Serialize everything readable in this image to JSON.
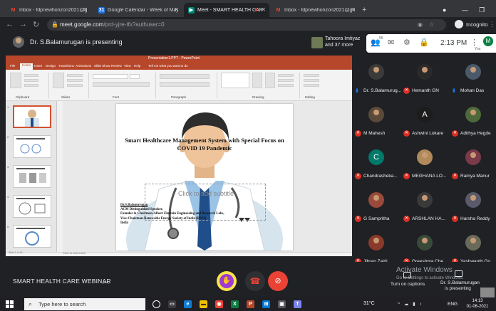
{
  "browser": {
    "tabs": [
      {
        "label": "Inbox - fdpnewhorizon2021@gm",
        "icon": "gmail-icon",
        "active": false
      },
      {
        "label": "Google Calendar - Week of May",
        "icon": "calendar-icon",
        "active": false
      },
      {
        "label": "Meet - SMART HEALTH CAR",
        "icon": "meet-icon",
        "active": true
      },
      {
        "label": "Inbox - fdpnewhorizon2021@gm",
        "icon": "gmail-icon",
        "active": false
      }
    ],
    "url_host": "meet.google.com",
    "url_path": "/prd-yjre-tfx?authuser=0",
    "incognito_label": "Incognito"
  },
  "meet_header": {
    "presenting": "Dr. S.Balamurugan is presenting",
    "others": "Tahoora Imtiyaz and 37 more",
    "people_count": "55",
    "time": "2:13 PM",
    "you_initial": "M",
    "you_label": "You"
  },
  "ppt": {
    "window_title": "Presentation1.PPT - PowerPoint",
    "menus": [
      "File",
      "Home",
      "Insert",
      "Design",
      "Transitions",
      "Animations",
      "Slide Show",
      "Review",
      "View",
      "Help",
      "Tell me what you want to do"
    ],
    "ribbon_groups": [
      "Clipboard",
      "Slides",
      "Font",
      "Paragraph",
      "Drawing",
      "Editing"
    ],
    "slide": {
      "title": "Smart Healthcare Management System with Special Focus on COVID 19 Pandemic",
      "subtitle_placeholder": "Click to add subtitle",
      "presenter_lines": [
        "Dr.S.Balamurugan",
        "ACM Distinguished Speaker,",
        "Founder & Chairman-Albert Einstein Engineering and Research Labs,",
        "Vice-Chairman-Renewable Energy Society of India (RESI)",
        "India"
      ]
    },
    "notes_placeholder": "Click to add notes",
    "status": "Slide 1 of 16"
  },
  "participants": [
    {
      "name": "Dr. S.Balamurug...",
      "avatar": "photo",
      "color": "#3b3b3b",
      "speaking": true
    },
    {
      "name": "Hemanth GN",
      "avatar": "photo",
      "color": "#2a2a2a",
      "speaking": false
    },
    {
      "name": "Mohan Das",
      "avatar": "photo",
      "color": "#4a5a6a",
      "speaking": true
    },
    {
      "name": "M Mahesh",
      "avatar": "photo",
      "color": "#5a4a3a",
      "speaking": false
    },
    {
      "name": "Ashwini Lokare",
      "avatar": "A",
      "color": "#1c1c1c",
      "speaking": false
    },
    {
      "name": "Adithya Hegde",
      "avatar": "photo",
      "color": "#4f6a3a",
      "speaking": false
    },
    {
      "name": "Chandrasheka...",
      "avatar": "C",
      "color": "#00796b",
      "speaking": false
    },
    {
      "name": "MEGHANA LO...",
      "avatar": "photo",
      "color": "#b08a5a",
      "speaking": false
    },
    {
      "name": "Ramya Manur",
      "avatar": "photo",
      "color": "#7a3a4a",
      "speaking": false
    },
    {
      "name": "G Sampritha",
      "avatar": "photo",
      "color": "#9a4a3a",
      "speaking": false
    },
    {
      "name": "ARSHLAN HA...",
      "avatar": "photo",
      "color": "#3a3a3a",
      "speaking": false
    },
    {
      "name": "Harsha Reddy",
      "avatar": "photo",
      "color": "#5a5a6a",
      "speaking": false
    },
    {
      "name": "Jibran Zaidi",
      "avatar": "photo",
      "color": "#8a3a2a",
      "speaking": false
    },
    {
      "name": "Greeshma Che...",
      "avatar": "photo",
      "color": "#3a4a3a",
      "speaking": false
    },
    {
      "name": "Yashwanth Go",
      "avatar": "photo",
      "color": "#6a6a5a",
      "speaking": false
    }
  ],
  "meet_bar": {
    "meeting_title": "SMART HEALTH CARE WEBINAR",
    "activate_title": "Activate Windows",
    "activate_sub": "Go to Settings to activate Windows.",
    "captions_label": "Turn on captions",
    "presenting_label_1": "Dr. S.Balamurugan",
    "presenting_label_2": "is presenting"
  },
  "taskbar": {
    "search_placeholder": "Type here to search",
    "weather": "31°C",
    "lang": "ENG",
    "time": "14:13",
    "date": "01-06-2021"
  },
  "colors": {
    "ppt_accent": "#b7472a",
    "meet_red": "#ea4335",
    "raise_hand": "#fbe44b"
  }
}
